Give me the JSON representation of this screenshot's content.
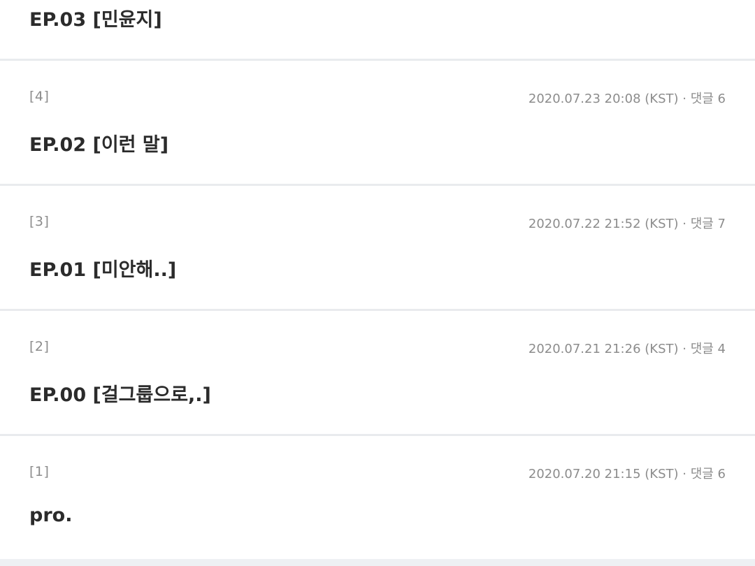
{
  "episodes": [
    {
      "title": "EP.03 [민윤지]"
    },
    {
      "number": "[4]",
      "date": "2020.07.23 20:08 (KST)",
      "comments": "댓글 6",
      "title": "EP.02 [이런 말]"
    },
    {
      "number": "[3]",
      "date": "2020.07.22 21:52 (KST)",
      "comments": "댓글 7",
      "title": "EP.01 [미안해..]"
    },
    {
      "number": "[2]",
      "date": "2020.07.21 21:26 (KST)",
      "comments": "댓글 4",
      "title": "EP.00 [걸그룹으로,.]"
    },
    {
      "number": "[1]",
      "date": "2020.07.20 21:15 (KST)",
      "comments": "댓글 6",
      "title": "pro."
    }
  ],
  "meta_separator": " · "
}
